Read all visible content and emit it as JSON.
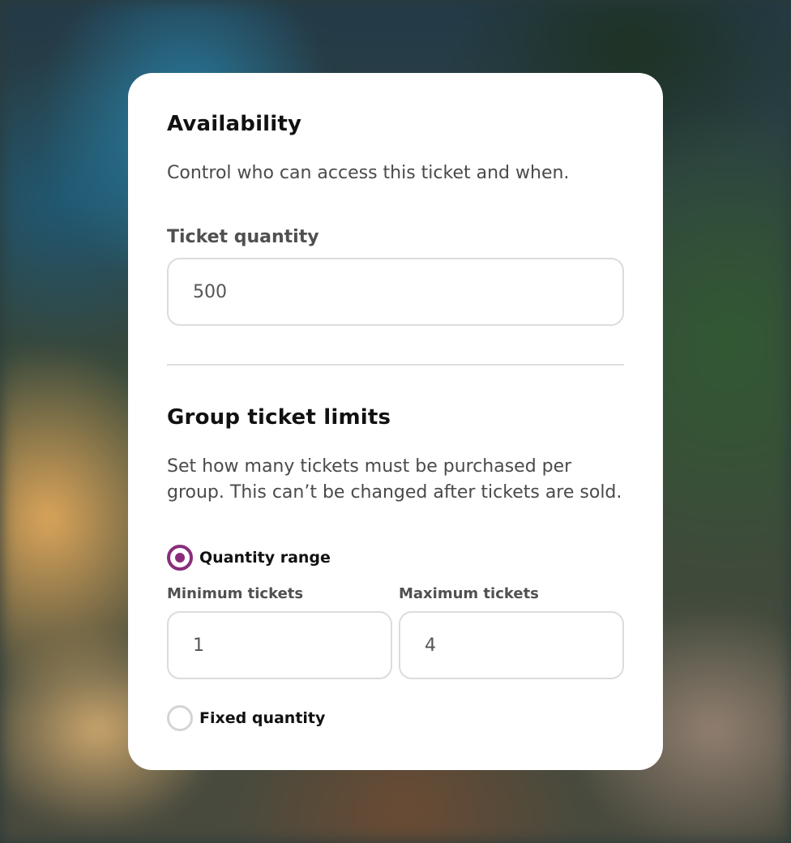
{
  "availability": {
    "title": "Availability",
    "description": "Control who can access this ticket and when.",
    "ticket_quantity": {
      "label": "Ticket quantity",
      "value": "500"
    }
  },
  "group_limits": {
    "title": "Group ticket limits",
    "description": "Set how many tickets must be purchased per group. This can’t be changed after tickets are sold.",
    "options": [
      {
        "label": "Quantity range",
        "selected": true
      },
      {
        "label": "Fixed quantity",
        "selected": false
      }
    ],
    "range": {
      "min_label": "Minimum tickets",
      "min_value": "1",
      "max_label": "Maximum tickets",
      "max_value": "4"
    }
  },
  "colors": {
    "accent": "#8a2c7c",
    "card_background": "#ffffff",
    "border": "#dcdcdc"
  }
}
